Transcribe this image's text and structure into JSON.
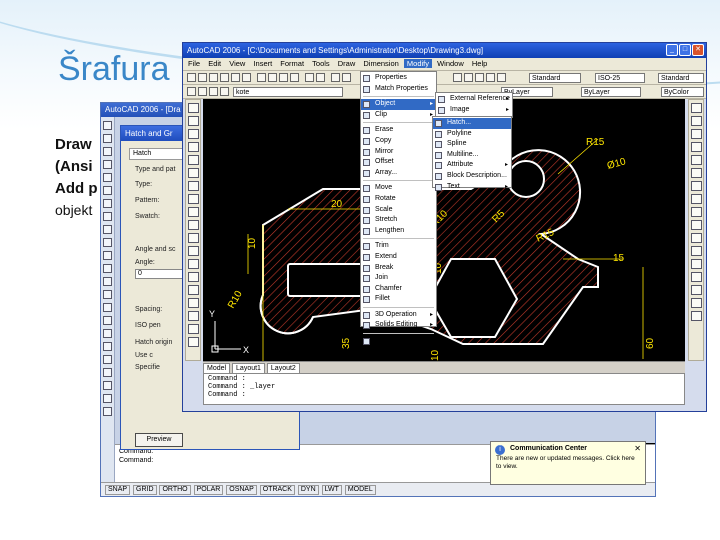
{
  "slide": {
    "title": "Šrafura",
    "lines": [
      "Draw",
      "(Ansi",
      "Add p",
      "objekt"
    ]
  },
  "background_window": {
    "title": "AutoCAD 2006 - [Dra",
    "dialog_title": "Hatch and Gr",
    "dialog_tab": "Hatch",
    "dialog_labels": [
      "Type and pat",
      "Type:",
      "Pattern:",
      "Swatch:",
      "Angle and sc",
      "Angle:",
      "0",
      "Spacing:",
      "ISO pen",
      "Hatch origin",
      "Use c",
      "Specifie"
    ],
    "dialog_button": "Preview",
    "cmd_lines": [
      "Command:",
      "Command:"
    ],
    "status_items": [
      "SNAP",
      "GRID",
      "ORTHO",
      "POLAR",
      "OSNAP",
      "OTRACK",
      "DYN",
      "LWT",
      "MODEL"
    ],
    "comm_title": "Communication Center",
    "comm_text": "There are new or updated messages. Click here to view."
  },
  "main_window": {
    "title": "AutoCAD 2006 - [C:\\Documents and Settings\\Administrator\\Desktop\\Drawing3.dwg]",
    "menus": [
      "File",
      "Edit",
      "View",
      "Insert",
      "Format",
      "Tools",
      "Draw",
      "Dimension",
      "Modify",
      "Window",
      "Help"
    ],
    "active_menu": "Modify",
    "style_combo": "Standard",
    "dimstyle_combo": "ISO-25",
    "table_combo": "Standard",
    "layer_combo": "ByLayer",
    "linetype_combo": "ByLayer",
    "color_combo": "ByColor",
    "layer_name": "kote",
    "tabs": [
      "Model",
      "Layout1",
      "Layout2"
    ],
    "command_lines": [
      "Command :",
      "Command : _layer",
      "Command :"
    ]
  },
  "modify_menu": [
    {
      "label": "Properties",
      "sub": false
    },
    {
      "label": "Match Properties",
      "sub": false
    },
    {
      "sep": true
    },
    {
      "label": "Object",
      "sub": true,
      "hl": true
    },
    {
      "label": "Clip",
      "sub": true
    },
    {
      "sep": true
    },
    {
      "label": "Erase",
      "sub": false
    },
    {
      "label": "Copy",
      "sub": false
    },
    {
      "label": "Mirror",
      "sub": false
    },
    {
      "label": "Offset",
      "sub": false
    },
    {
      "label": "Array...",
      "sub": false
    },
    {
      "sep": true
    },
    {
      "label": "Move",
      "sub": false
    },
    {
      "label": "Rotate",
      "sub": false
    },
    {
      "label": "Scale",
      "sub": false
    },
    {
      "label": "Stretch",
      "sub": false
    },
    {
      "label": "Lengthen",
      "sub": false
    },
    {
      "sep": true
    },
    {
      "label": "Trim",
      "sub": false
    },
    {
      "label": "Extend",
      "sub": false
    },
    {
      "label": "Break",
      "sub": false
    },
    {
      "label": "Join",
      "sub": false
    },
    {
      "label": "Chamfer",
      "sub": false
    },
    {
      "label": "Fillet",
      "sub": false
    },
    {
      "sep": true
    },
    {
      "label": "3D Operation",
      "sub": true
    },
    {
      "label": "Solids Editing",
      "sub": true
    },
    {
      "sep": true
    },
    {
      "label": "Explode",
      "sub": false
    }
  ],
  "object_menu": [
    "External Reference",
    "Image"
  ],
  "object_submenu": [
    {
      "label": "Hatch...",
      "hl": true
    },
    {
      "label": "Polyline"
    },
    {
      "label": "Spline"
    },
    {
      "label": "Multiline..."
    },
    {
      "label": "Attribute",
      "sub": true
    },
    {
      "label": "Block Description..."
    },
    {
      "label": "Text",
      "sub": true
    }
  ],
  "drawing": {
    "dims": [
      "R15",
      "20",
      "R10",
      "10",
      "R5",
      "Ø10",
      "15",
      "R15",
      "R10",
      "10",
      "30",
      "35",
      "10",
      "85",
      "160",
      "60"
    ],
    "ucs_x": "X",
    "ucs_y": "Y"
  },
  "colors": {
    "hatch": "#c0392b",
    "outline": "#ffffff",
    "dim": "#ffe600",
    "title_accent": "#3a87c8"
  }
}
